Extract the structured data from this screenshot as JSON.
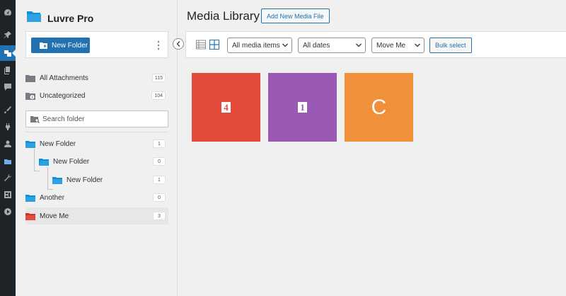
{
  "brand": {
    "name": "Luvre Pro"
  },
  "toolbar": {
    "new_folder_label": "New Folder"
  },
  "default_folders": [
    {
      "label": "All Attachments",
      "count": "115"
    },
    {
      "label": "Uncategorized",
      "count": "104"
    }
  ],
  "search": {
    "placeholder": "Search folder"
  },
  "folders": [
    {
      "label": "New Folder",
      "count": "1",
      "color": "#2ea2e0"
    },
    {
      "label": "New Folder",
      "count": "0",
      "color": "#2ea2e0"
    },
    {
      "label": "New Folder",
      "count": "1",
      "color": "#2ea2e0"
    },
    {
      "label": "Another",
      "count": "0",
      "color": "#2ea2e0"
    },
    {
      "label": "Move Me",
      "count": "3",
      "color": "#e34c3c"
    }
  ],
  "page": {
    "title": "Media Library",
    "add_new_label": "Add New Media File"
  },
  "filters": {
    "type": "All media items",
    "date": "All dates",
    "folder": "Move Me",
    "bulk_label": "Bulk select"
  },
  "media": [
    {
      "label": "4",
      "color": "#e34c3c",
      "style": "square"
    },
    {
      "label": "1",
      "color": "#9b59b6",
      "style": "square"
    },
    {
      "label": "C",
      "color": "#f0903a",
      "style": "big"
    }
  ],
  "colors": {
    "accent": "#2271b1",
    "adminbar": "#1d2327"
  },
  "icons": [
    "dashboard-icon",
    "pin-icon",
    "media-icon",
    "pages-icon",
    "comments-icon",
    "appearance-icon",
    "plugins-icon",
    "users-icon",
    "folder-icon",
    "tools-icon",
    "settings-icon",
    "play-icon"
  ]
}
